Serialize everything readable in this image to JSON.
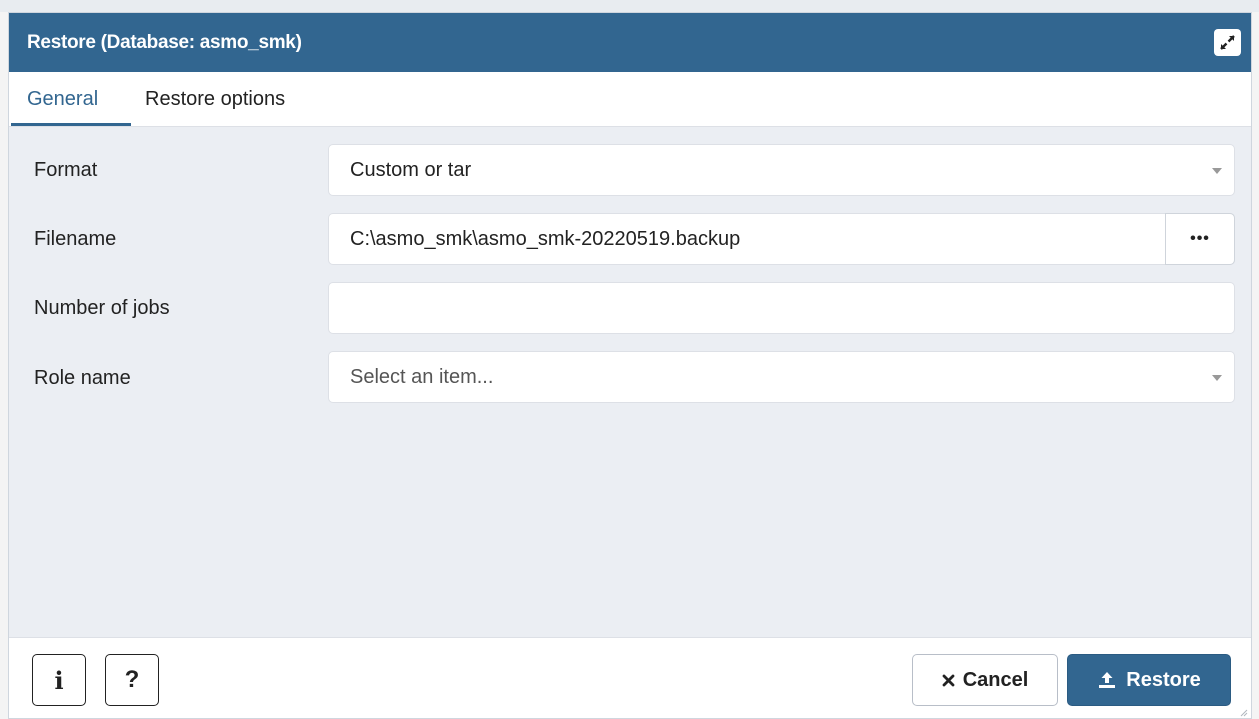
{
  "dialog": {
    "title": "Restore (Database: asmo_smk)",
    "maximize_icon": "expand-icon"
  },
  "tabs": [
    {
      "label": "General",
      "active": true
    },
    {
      "label": "Restore options",
      "active": false
    }
  ],
  "form": {
    "format": {
      "label": "Format",
      "value": "Custom or tar"
    },
    "filename": {
      "label": "Filename",
      "value": "C:\\asmo_smk\\asmo_smk-20220519.backup",
      "browse_label": "•••"
    },
    "jobs": {
      "label": "Number of jobs",
      "value": ""
    },
    "role": {
      "label": "Role name",
      "placeholder": "Select an item..."
    }
  },
  "footer": {
    "info_label": "i",
    "help_label": "?",
    "cancel_label": "Cancel",
    "restore_label": "Restore"
  },
  "colors": {
    "accent": "#326690",
    "body_bg": "#ebeef3",
    "text": "#222222"
  }
}
